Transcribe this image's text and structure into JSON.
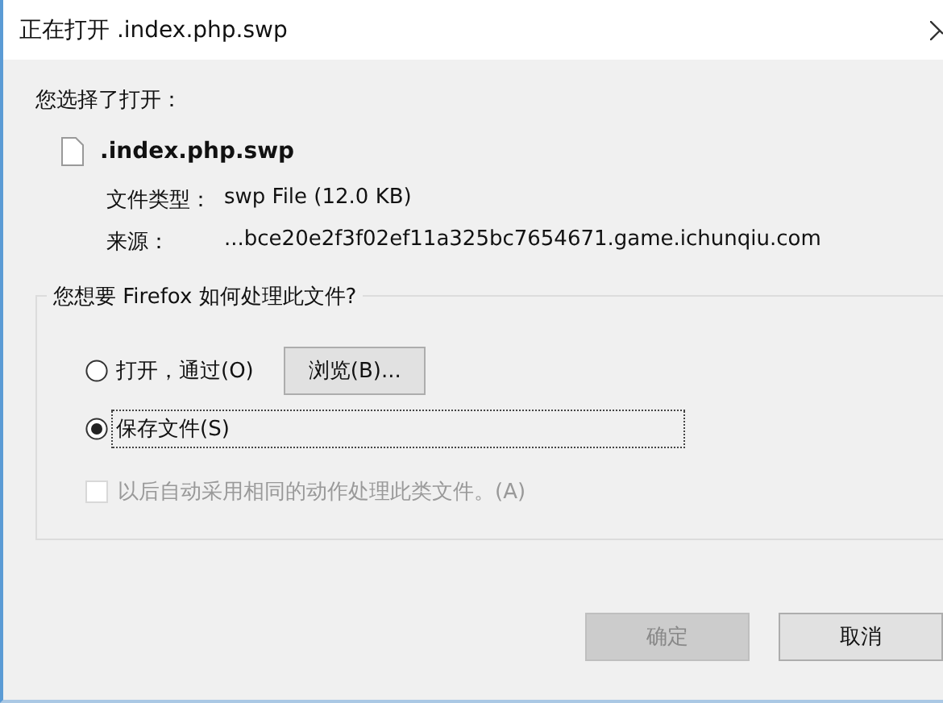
{
  "window": {
    "title": "正在打开 .index.php.swp"
  },
  "intro": "您选择了打开：",
  "file": {
    "name": ".index.php.swp",
    "type_label": "文件类型：",
    "type_value": "swp File (12.0 KB)",
    "source_label": "来源：",
    "source_value": "...bce20e2f3f02ef11a325bc7654671.game.ichunqiu.com"
  },
  "group": {
    "title": "您想要 Firefox 如何处理此文件?",
    "options": [
      {
        "label": "打开，通过(O)",
        "selected": false
      },
      {
        "label": "保存文件(S)",
        "selected": true
      }
    ],
    "browse_button": {
      "label": "浏览(B)..."
    },
    "remember": {
      "label": "以后自动采用相同的动作处理此类文件。(A)",
      "checked": false,
      "disabled": true
    }
  },
  "buttons": [
    {
      "label": "确定",
      "disabled": true
    },
    {
      "label": "取消",
      "disabled": false
    }
  ]
}
